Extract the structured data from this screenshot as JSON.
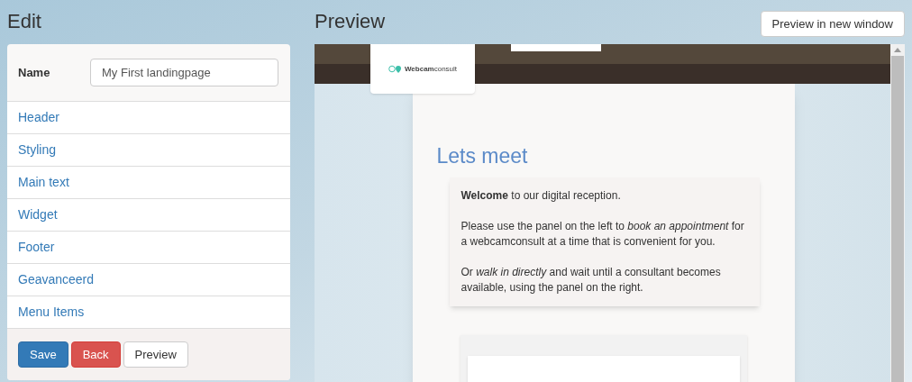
{
  "edit": {
    "title": "Edit",
    "name_label": "Name",
    "name_value": "My First landingpage",
    "sections": [
      "Header",
      "Styling",
      "Main text",
      "Widget",
      "Footer",
      "Geavanceerd",
      "Menu Items"
    ],
    "buttons": [
      {
        "label": "Save",
        "kind": "primary"
      },
      {
        "label": "Back",
        "kind": "danger"
      },
      {
        "label": "Preview",
        "kind": "default"
      }
    ]
  },
  "preview": {
    "title": "Preview",
    "open_button": "Preview in new window",
    "logo": "**Webcam**consult",
    "heading": "Lets meet",
    "paragraphs": [
      "**Welcome** to our digital reception.",
      "Please use the panel on the left to *book an appointment* for a webcamconsult at a time that is convenient for you.",
      "Or *walk in directly* and wait until a consultant becomes available, using the panel on the right."
    ]
  }
}
